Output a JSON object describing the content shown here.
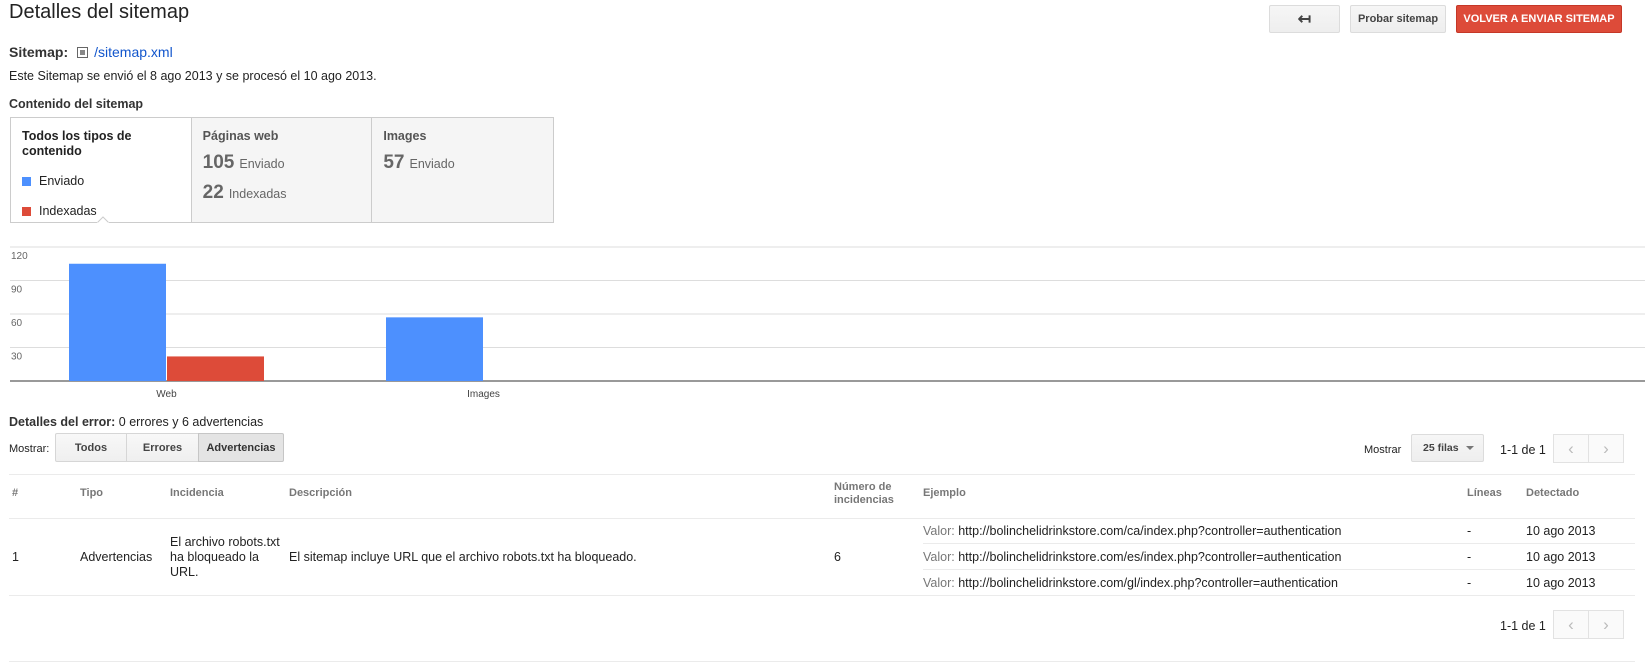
{
  "page_title": "Detalles del sitemap",
  "toolbar": {
    "back_icon": "↤",
    "test_label": "Probar sitemap",
    "resubmit_label": "VOLVER A ENVIAR SITEMAP"
  },
  "sitemap": {
    "label": "Sitemap:",
    "file": "/sitemap.xml",
    "processed_text": "Este Sitemap se envió el 8 ago 2013 y se procesó el 10 ago 2013."
  },
  "contents": {
    "title": "Contenido del sitemap",
    "all_types": "Todos los tipos de contenido",
    "legend": [
      {
        "label": "Enviado",
        "color": "#4d90fe"
      },
      {
        "label": "Indexadas",
        "color": "#dd4b39"
      }
    ],
    "web": {
      "title": "Páginas web",
      "submitted_num": "105",
      "submitted_word": "Enviado",
      "indexed_num": "22",
      "indexed_word": "Indexadas"
    },
    "images": {
      "title": "Images",
      "submitted_num": "57",
      "submitted_word": "Enviado"
    }
  },
  "chart_data": {
    "type": "bar",
    "categories": [
      "Web",
      "Images"
    ],
    "series": [
      {
        "name": "Enviado",
        "values": [
          105,
          57
        ],
        "color": "#4d90fe"
      },
      {
        "name": "Indexadas",
        "values": [
          22,
          null
        ],
        "color": "#dd4b39"
      }
    ],
    "yticks": [
      30,
      60,
      90,
      120
    ],
    "ylim": [
      0,
      120
    ]
  },
  "errors": {
    "title_bold": "Detalles del error:",
    "title_rest": " 0 errores y 6 advertencias",
    "show_label": "Mostrar:",
    "filters": [
      "Todos",
      "Errores",
      "Advertencias"
    ],
    "rows_label": "Mostrar",
    "rows_value": "25 filas",
    "range": "1-1 de 1",
    "prev_icon": "‹",
    "next_icon": "›"
  },
  "table": {
    "headers": {
      "num": "#",
      "type": "Tipo",
      "issue": "Incidencia",
      "description": "Descripción",
      "count": "Número de incidencias",
      "example": "Ejemplo",
      "lines": "Líneas",
      "detected": "Detectado"
    },
    "row": {
      "num": "1",
      "type": "Advertencias",
      "issue": "El archivo robots.txt ha bloqueado la URL.",
      "description": "El sitemap incluye URL que el archivo robots.txt ha bloqueado.",
      "count": "6",
      "examples": [
        {
          "label": "Valor:",
          "url": "http://bolinchelidrinkstore.com/ca/index.php?controller=authentication",
          "lines": "-",
          "detected": "10 ago 2013"
        },
        {
          "label": "Valor:",
          "url": "http://bolinchelidrinkstore.com/es/index.php?controller=authentication",
          "lines": "-",
          "detected": "10 ago 2013"
        },
        {
          "label": "Valor:",
          "url": "http://bolinchelidrinkstore.com/gl/index.php?controller=authentication",
          "lines": "-",
          "detected": "10 ago 2013"
        }
      ]
    }
  }
}
